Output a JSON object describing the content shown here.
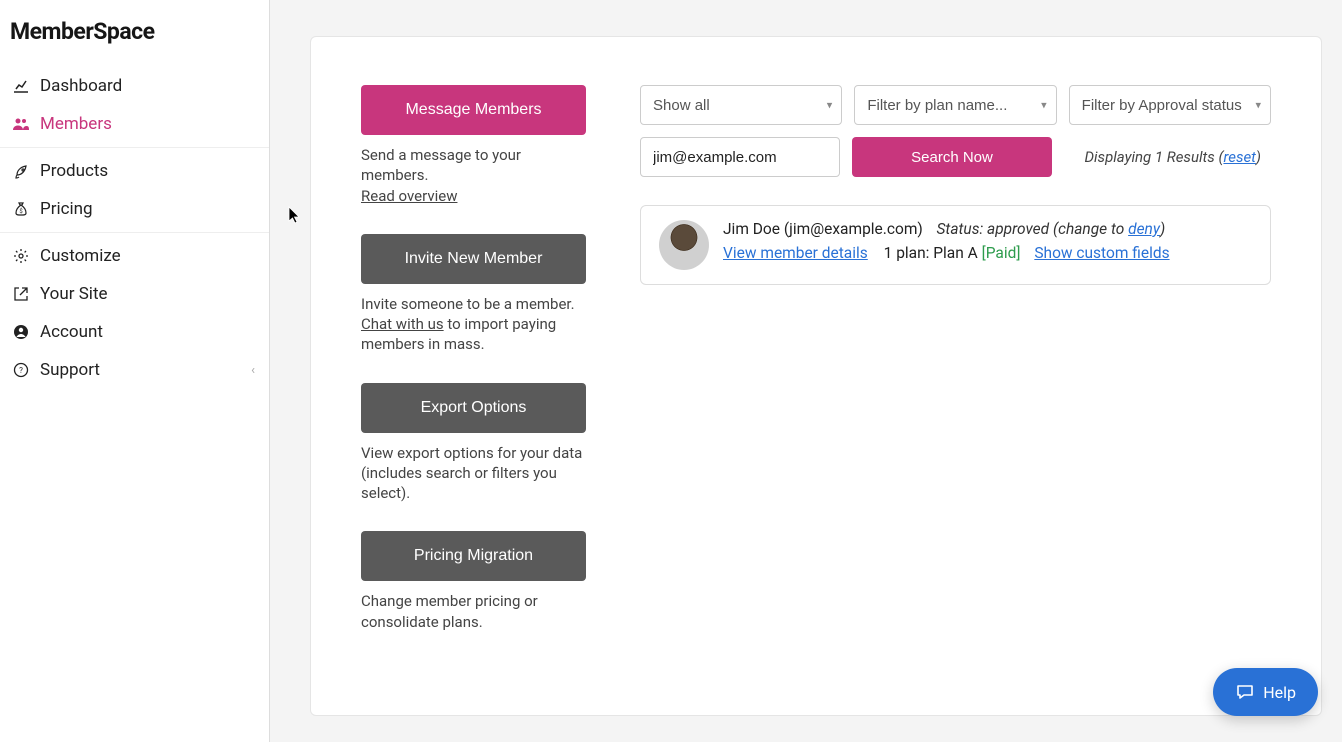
{
  "logo": "MemberSpace",
  "sidebar": {
    "items": [
      {
        "label": "Dashboard",
        "icon": "chart-line-icon"
      },
      {
        "label": "Members",
        "icon": "users-icon",
        "active": true
      },
      {
        "label": "Products",
        "icon": "rocket-icon"
      },
      {
        "label": "Pricing",
        "icon": "money-bag-icon"
      },
      {
        "label": "Customize",
        "icon": "gear-icon"
      },
      {
        "label": "Your Site",
        "icon": "external-link-icon"
      },
      {
        "label": "Account",
        "icon": "user-circle-icon"
      },
      {
        "label": "Support",
        "icon": "question-circle-icon",
        "chevron": true
      }
    ]
  },
  "actions": {
    "message": {
      "button": "Message Members",
      "helper": "Send a message to your members.",
      "link": "Read overview"
    },
    "invite": {
      "button": "Invite New Member",
      "helper_pre": "Invite someone to be a member.",
      "link": "Chat with us",
      "helper_post": " to import paying members in mass."
    },
    "export": {
      "button": "Export Options",
      "helper": "View export options for your data (includes search or filters you select)."
    },
    "pricing": {
      "button": "Pricing Migration",
      "helper": "Change member pricing or consolidate plans."
    }
  },
  "filters": {
    "show": "Show all",
    "plan_placeholder": "Filter by plan name...",
    "approval_placeholder": "Filter by Approval status...",
    "search_value": "jim@example.com",
    "search_button": "Search Now"
  },
  "results": {
    "text_pre": "Displaying 1 Results (",
    "reset": "reset",
    "text_post": ")"
  },
  "member": {
    "name": "Jim Doe",
    "email": "(jim@example.com)",
    "status_label": "Status:",
    "status_value": "approved",
    "change_pre": "(change to ",
    "change_link": "deny",
    "change_post": ")",
    "view_details": "View member details",
    "plan_text": "1 plan: Plan A ",
    "paid": "[Paid]",
    "custom_fields": "Show custom fields"
  },
  "help": "Help"
}
